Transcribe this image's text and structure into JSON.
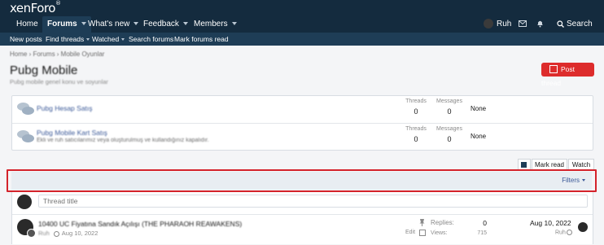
{
  "brand": {
    "logo_main": "xenForo",
    "logo_sup": "®"
  },
  "nav": {
    "items": [
      {
        "label": "Home"
      },
      {
        "label": "Forums"
      },
      {
        "label": "What's new"
      },
      {
        "label": "Feedback"
      },
      {
        "label": "Members"
      }
    ],
    "user": "Ruh",
    "search": "Search"
  },
  "subnav": [
    "New posts",
    "Find threads",
    "Watched",
    "Search forums",
    "Mark forums read"
  ],
  "breadcrumb": "Home › Forums › Mobile Oyunlar",
  "page": {
    "title": "Pubg Mobile",
    "description": "Pubg mobile genel konu ve soyunlar",
    "post_thread": "Post thread"
  },
  "subforums": [
    {
      "title": "Pubg Hesap Satış",
      "description": "",
      "threads_label": "Threads",
      "threads": "0",
      "messages_label": "Messages",
      "messages": "0",
      "last": "None"
    },
    {
      "title": "Pubg Mobile Kart Satış",
      "description": "Ekli ve ruh satıcılarımız veya oluşturulmuş ve kullandığınız kapalıdır.",
      "threads_label": "Threads",
      "threads": "0",
      "messages_label": "Messages",
      "messages": "0",
      "last": "None"
    }
  ],
  "toolbar": {
    "mark_read": "Mark read",
    "watch": "Watch"
  },
  "filters": {
    "label": "Filters"
  },
  "quick_thread": {
    "placeholder": "Thread title"
  },
  "threads": [
    {
      "title": "10400 UC Fiyatına Sandık Açılışı (THE PHARAOH REAWAKENS)",
      "author": "Ruh",
      "date": "Aug 10, 2022",
      "edit": "Edit",
      "replies_label": "Replies:",
      "replies": "0",
      "views_label": "Views:",
      "views": "715",
      "last_date": "Aug 10, 2022",
      "last_user": "Ruh"
    }
  ],
  "colors": {
    "header_bg": "#142b3e",
    "subnav_bg": "#1e3d56",
    "accent_red": "#dd2c2c",
    "highlight": "#d4232b"
  }
}
